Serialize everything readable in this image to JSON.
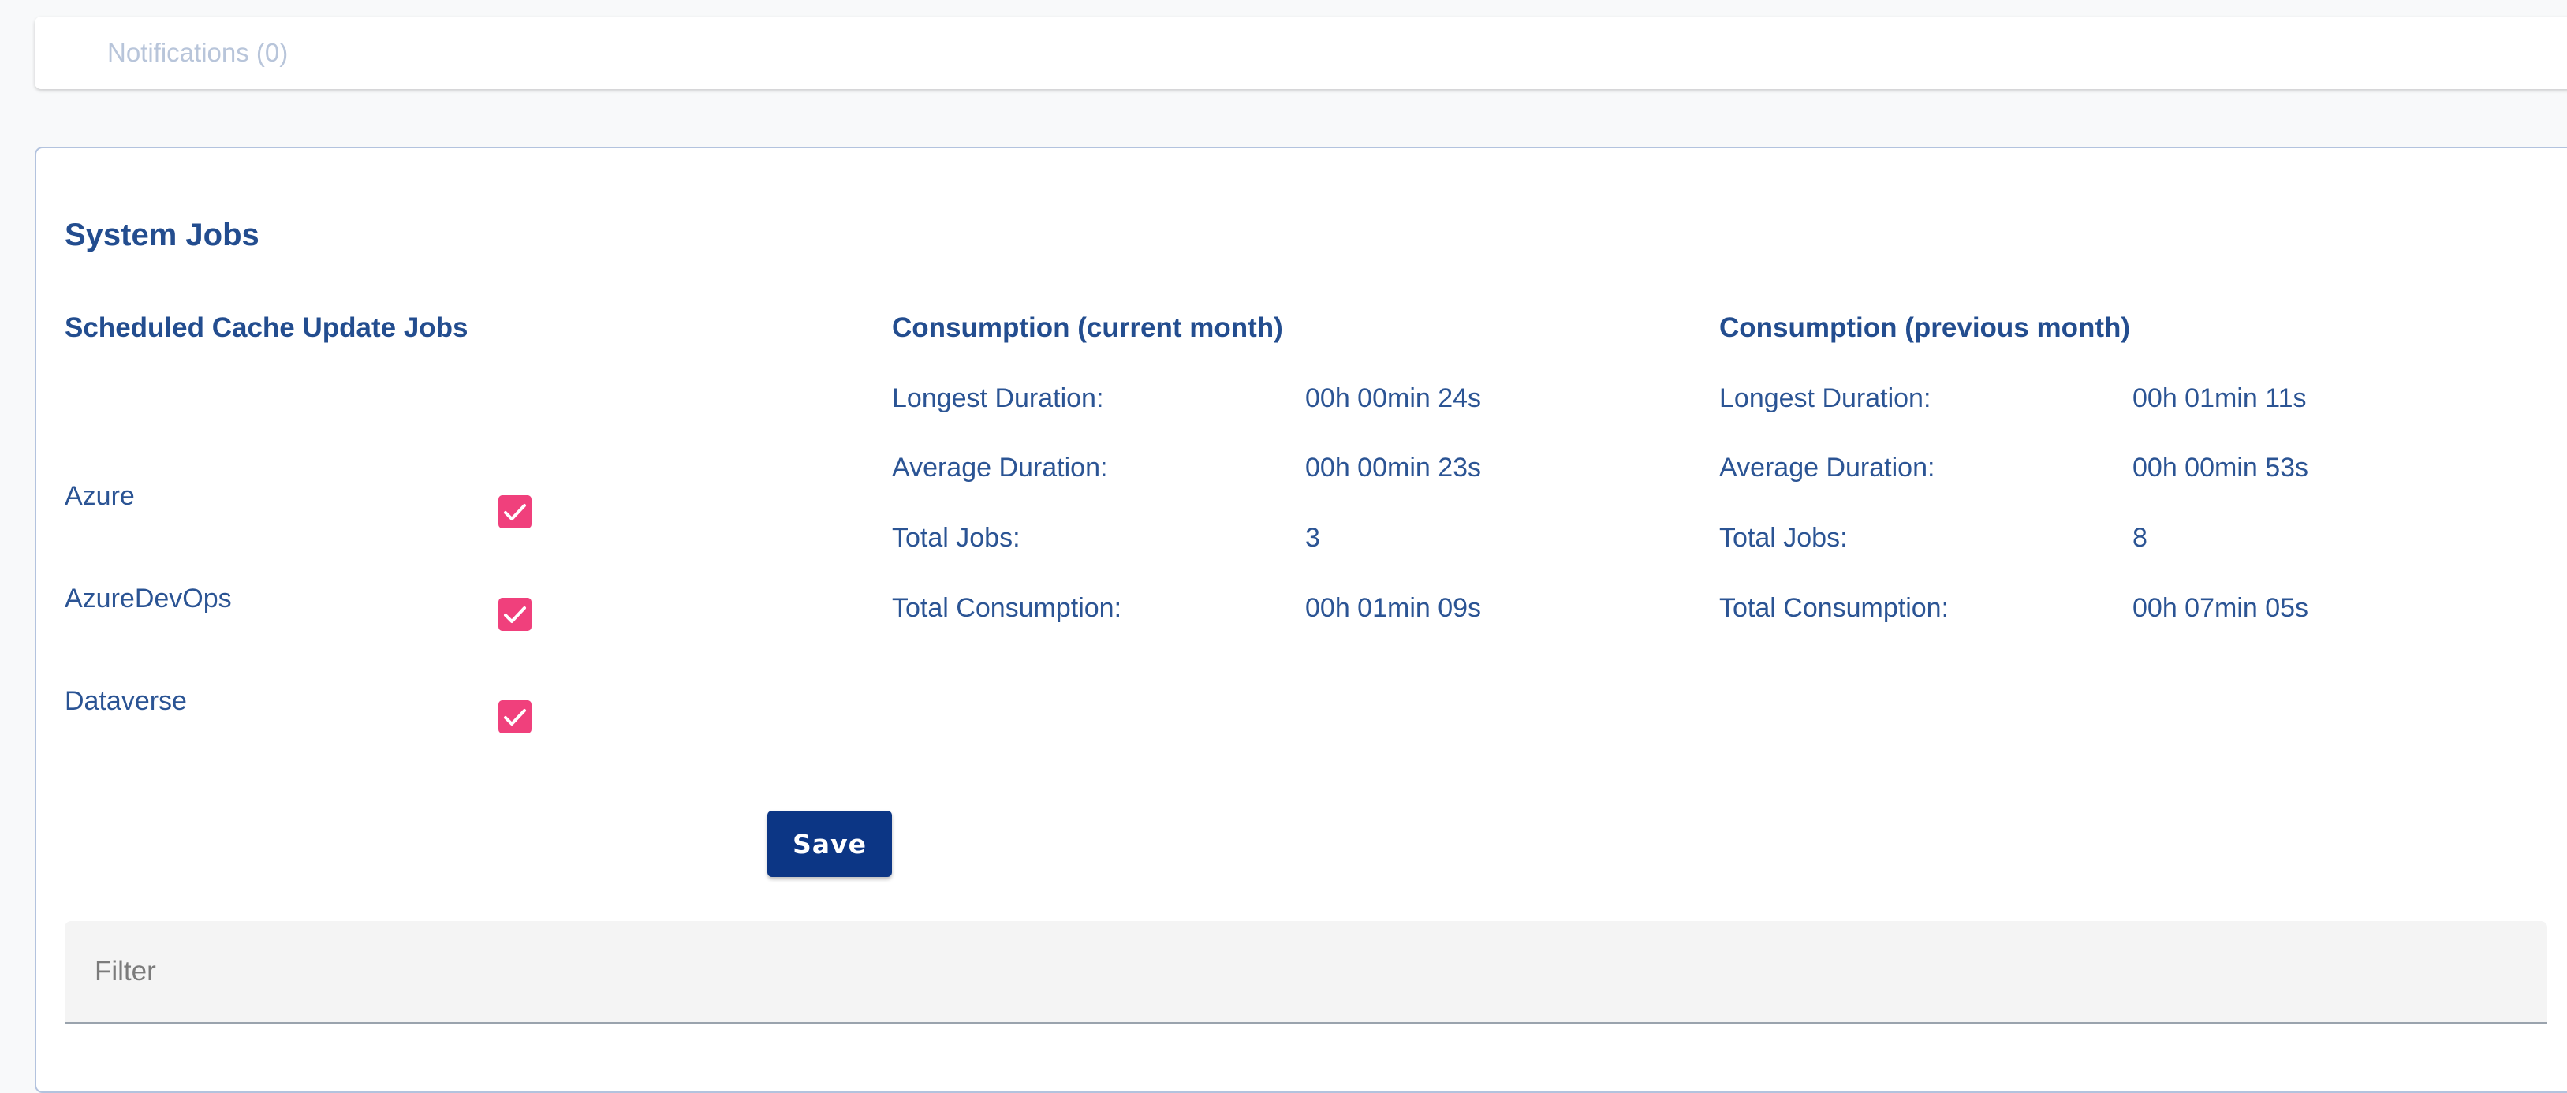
{
  "notifications": {
    "tab_label": "Notifications (0)"
  },
  "panel": {
    "title": "System Jobs",
    "scheduled": {
      "heading": "Scheduled Cache Update Jobs",
      "jobs": [
        {
          "label": "Azure",
          "checked": true
        },
        {
          "label": "AzureDevOps",
          "checked": true
        },
        {
          "label": "Dataverse",
          "checked": true
        }
      ]
    },
    "current_month": {
      "heading": "Consumption (current month)",
      "rows": [
        {
          "label": "Longest Duration:",
          "value": "00h 00min 24s"
        },
        {
          "label": "Average Duration:",
          "value": "00h 00min 23s"
        },
        {
          "label": "Total Jobs:",
          "value": "3"
        },
        {
          "label": "Total Consumption:",
          "value": "00h 01min 09s"
        }
      ]
    },
    "previous_month": {
      "heading": "Consumption (previous month)",
      "rows": [
        {
          "label": "Longest Duration:",
          "value": "00h 01min 11s"
        },
        {
          "label": "Average Duration:",
          "value": "00h 00min 53s"
        },
        {
          "label": "Total Jobs:",
          "value": "8"
        },
        {
          "label": "Total Consumption:",
          "value": "00h 07min 05s"
        }
      ]
    },
    "save_label": "Save",
    "filter": {
      "placeholder": "Filter",
      "value": ""
    }
  },
  "colors": {
    "heading": "#234d8f",
    "text": "#2b5494",
    "checkbox": "#f0407c",
    "save_button": "#0c3685",
    "notification_tab": "#b8c5da"
  },
  "icons": {
    "checkbox": "check-icon"
  }
}
